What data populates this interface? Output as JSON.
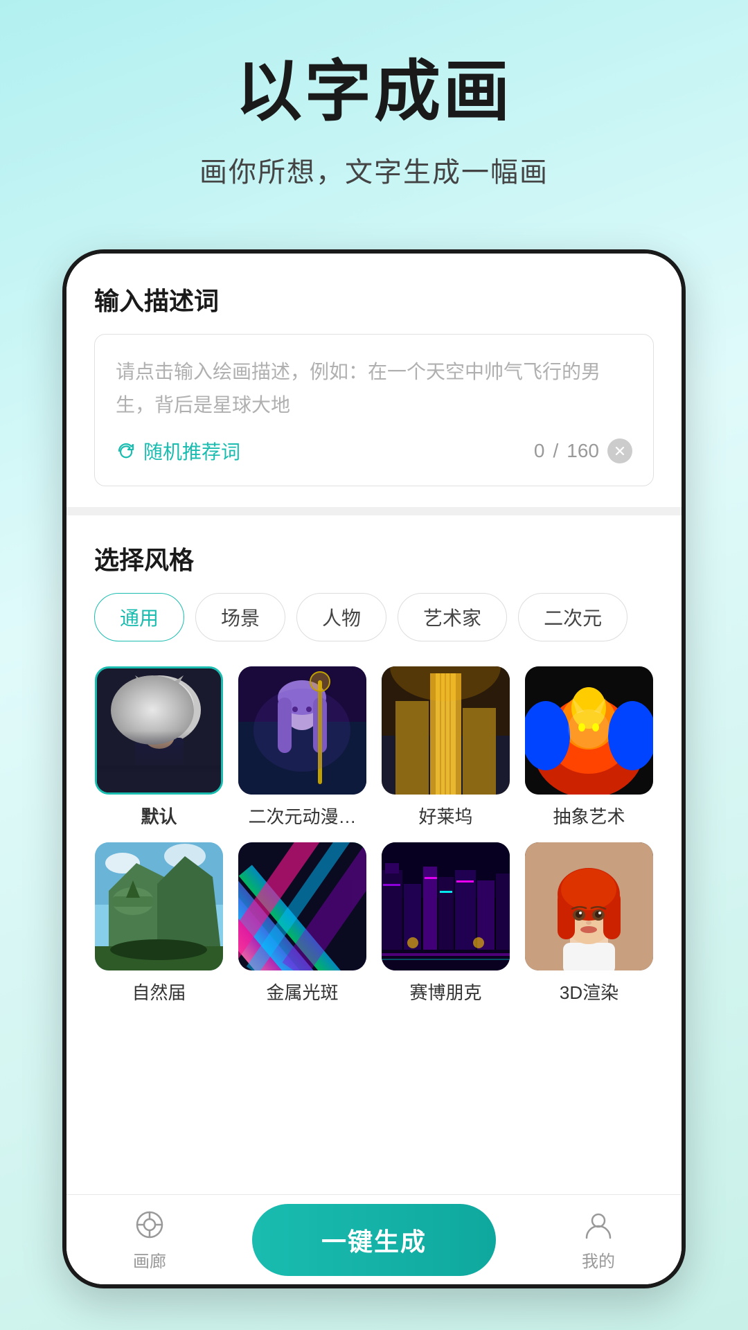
{
  "header": {
    "main_title": "以字成画",
    "sub_title": "画你所想，文字生成一幅画"
  },
  "input_section": {
    "label": "输入描述词",
    "placeholder": "请点击输入绘画描述，例如：在一个天空中帅气飞行的男生，背后是星球大地",
    "random_label": "随机推荐词",
    "char_count": "0",
    "char_max": "160"
  },
  "style_section": {
    "label": "选择风格",
    "tags": [
      {
        "label": "通用",
        "active": true
      },
      {
        "label": "场景",
        "active": false
      },
      {
        "label": "人物",
        "active": false
      },
      {
        "label": "艺术家",
        "active": false
      },
      {
        "label": "二次元",
        "active": false
      }
    ],
    "items": [
      {
        "name": "默认",
        "bold": true,
        "selected": true
      },
      {
        "name": "二次元动漫…",
        "bold": false,
        "selected": false
      },
      {
        "name": "好莱坞",
        "bold": false,
        "selected": false
      },
      {
        "name": "抽象艺术",
        "bold": false,
        "selected": false
      },
      {
        "name": "自然届",
        "bold": false,
        "selected": false
      },
      {
        "name": "金属光斑",
        "bold": false,
        "selected": false
      },
      {
        "name": "赛博朋克",
        "bold": false,
        "selected": false
      },
      {
        "name": "3D渲染",
        "bold": false,
        "selected": false
      }
    ]
  },
  "bottom_bar": {
    "gallery_label": "画廊",
    "generate_label": "一键生成",
    "profile_label": "我的"
  }
}
